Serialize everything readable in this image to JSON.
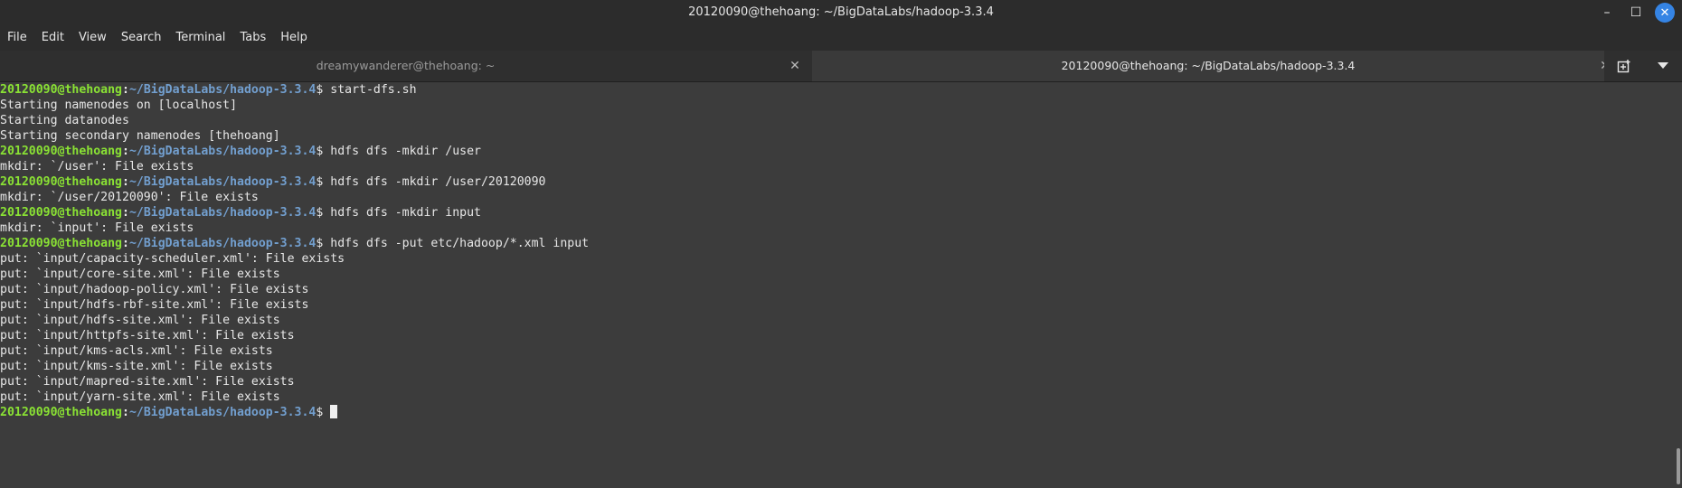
{
  "window": {
    "title": "20120090@thehoang: ~/BigDataLabs/hadoop-3.3.4",
    "minimize_glyph": "–",
    "maximize_glyph": "☐",
    "close_glyph": "✕"
  },
  "menubar": {
    "file": "File",
    "edit": "Edit",
    "view": "View",
    "search": "Search",
    "terminal": "Terminal",
    "tabs": "Tabs",
    "help": "Help"
  },
  "tabs": {
    "inactive": {
      "label": "dreamywanderer@thehoang: ~",
      "close": "✕"
    },
    "active": {
      "label": "20120090@thehoang: ~/BigDataLabs/hadoop-3.3.4",
      "close": "✕"
    }
  },
  "prompt": {
    "user_host": "20120090@thehoang",
    "sep": ":",
    "path": "~/BigDataLabs/hadoop-3.3.4",
    "dollar": "$ "
  },
  "lines": {
    "l0": "start-dfs.sh",
    "l1": "Starting namenodes on [localhost]",
    "l2": "Starting datanodes",
    "l3": "Starting secondary namenodes [thehoang]",
    "l4": "hdfs dfs -mkdir /user",
    "l5": "mkdir: `/user': File exists",
    "l6": "hdfs dfs -mkdir /user/20120090",
    "l7": "mkdir: `/user/20120090': File exists",
    "l8": "hdfs dfs -mkdir input",
    "l9": "mkdir: `input': File exists",
    "l10": "hdfs dfs -put etc/hadoop/*.xml input",
    "l11": "put: `input/capacity-scheduler.xml': File exists",
    "l12": "put: `input/core-site.xml': File exists",
    "l13": "put: `input/hadoop-policy.xml': File exists",
    "l14": "put: `input/hdfs-rbf-site.xml': File exists",
    "l15": "put: `input/hdfs-site.xml': File exists",
    "l16": "put: `input/httpfs-site.xml': File exists",
    "l17": "put: `input/kms-acls.xml': File exists",
    "l18": "put: `input/kms-site.xml': File exists",
    "l19": "put: `input/mapred-site.xml': File exists",
    "l20": "put: `input/yarn-site.xml': File exists"
  },
  "colors": {
    "background": "#3c3c3c",
    "prompt_user": "#8ae234",
    "prompt_path": "#729fcf",
    "text": "#e7e7e7",
    "close_button": "#3584e4"
  }
}
